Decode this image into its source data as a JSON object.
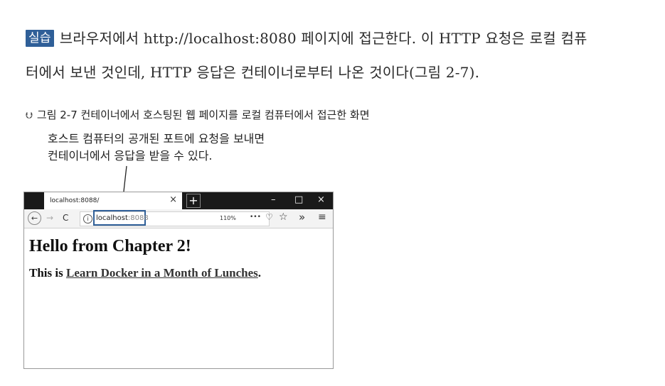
{
  "practice": {
    "badge": "실습",
    "line1": "브라우저에서 http://localhost:8080 페이지에 접근한다. 이 HTTP 요청은 로컬 컴퓨",
    "line2": "터에서 보낸 것인데, HTTP 응답은 컨테이너로부터 나온 것이다(그림 2-7)."
  },
  "figure": {
    "caption": "그림 2-7  컨테이너에서 호스팅된 웹 페이지를 로컬 컴퓨터에서 접근한 화면",
    "callout_line1": "호스트 컴퓨터의 공개된 포트에 요청을 보내면",
    "callout_line2": "컨테이너에서 응답을 받을 수 있다."
  },
  "browser": {
    "tab_title": "localhost:8088/",
    "tab_close": "×",
    "new_tab": "+",
    "minimize": "–",
    "maximize": "□",
    "close": "×",
    "back": "←",
    "forward": "→",
    "reload": "C",
    "info": "i",
    "url_host": "localhost",
    "url_port": ":8088",
    "zoom": "110%",
    "more": "•••",
    "pocket": "♡",
    "bookmark": "☆",
    "overflow": "»",
    "menu": "≡",
    "page": {
      "heading": "Hello from Chapter 2!",
      "text_prefix": "This is ",
      "link_text": "Learn Docker in a Month of Lunches",
      "text_suffix": "."
    }
  }
}
